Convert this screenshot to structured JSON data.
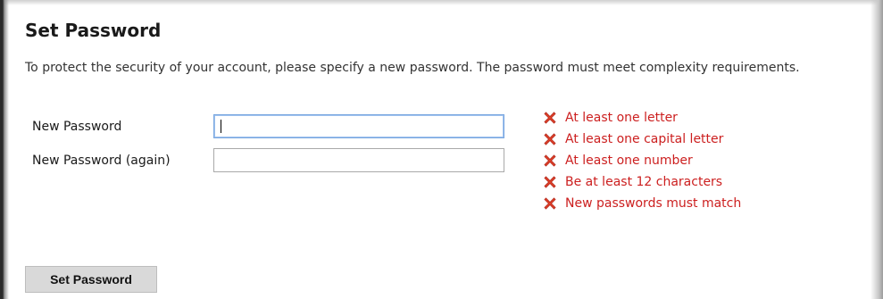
{
  "form": {
    "title": "Set Password",
    "intro": "To protect the security of your account, please specify a new password. The password must meet complexity requirements.",
    "new_password_label": "New Password",
    "new_password_value": "",
    "confirm_password_label": "New Password (again)",
    "confirm_password_value": "",
    "submit_label": "Set Password"
  },
  "requirements": [
    {
      "label": "At least one letter",
      "met": false,
      "icon": "red-x-icon"
    },
    {
      "label": "At least one capital letter",
      "met": false,
      "icon": "red-x-icon"
    },
    {
      "label": "At least one number",
      "met": false,
      "icon": "red-x-icon"
    },
    {
      "label": "Be at least 12 characters",
      "met": false,
      "icon": "red-x-icon"
    },
    {
      "label": "New passwords must match",
      "met": false,
      "icon": "red-x-icon"
    }
  ],
  "colors": {
    "error_text": "#cc1f1f",
    "icon_red": "#e2432a",
    "button_bg": "#d9d9d9",
    "focus_border": "#7aa7e0"
  }
}
